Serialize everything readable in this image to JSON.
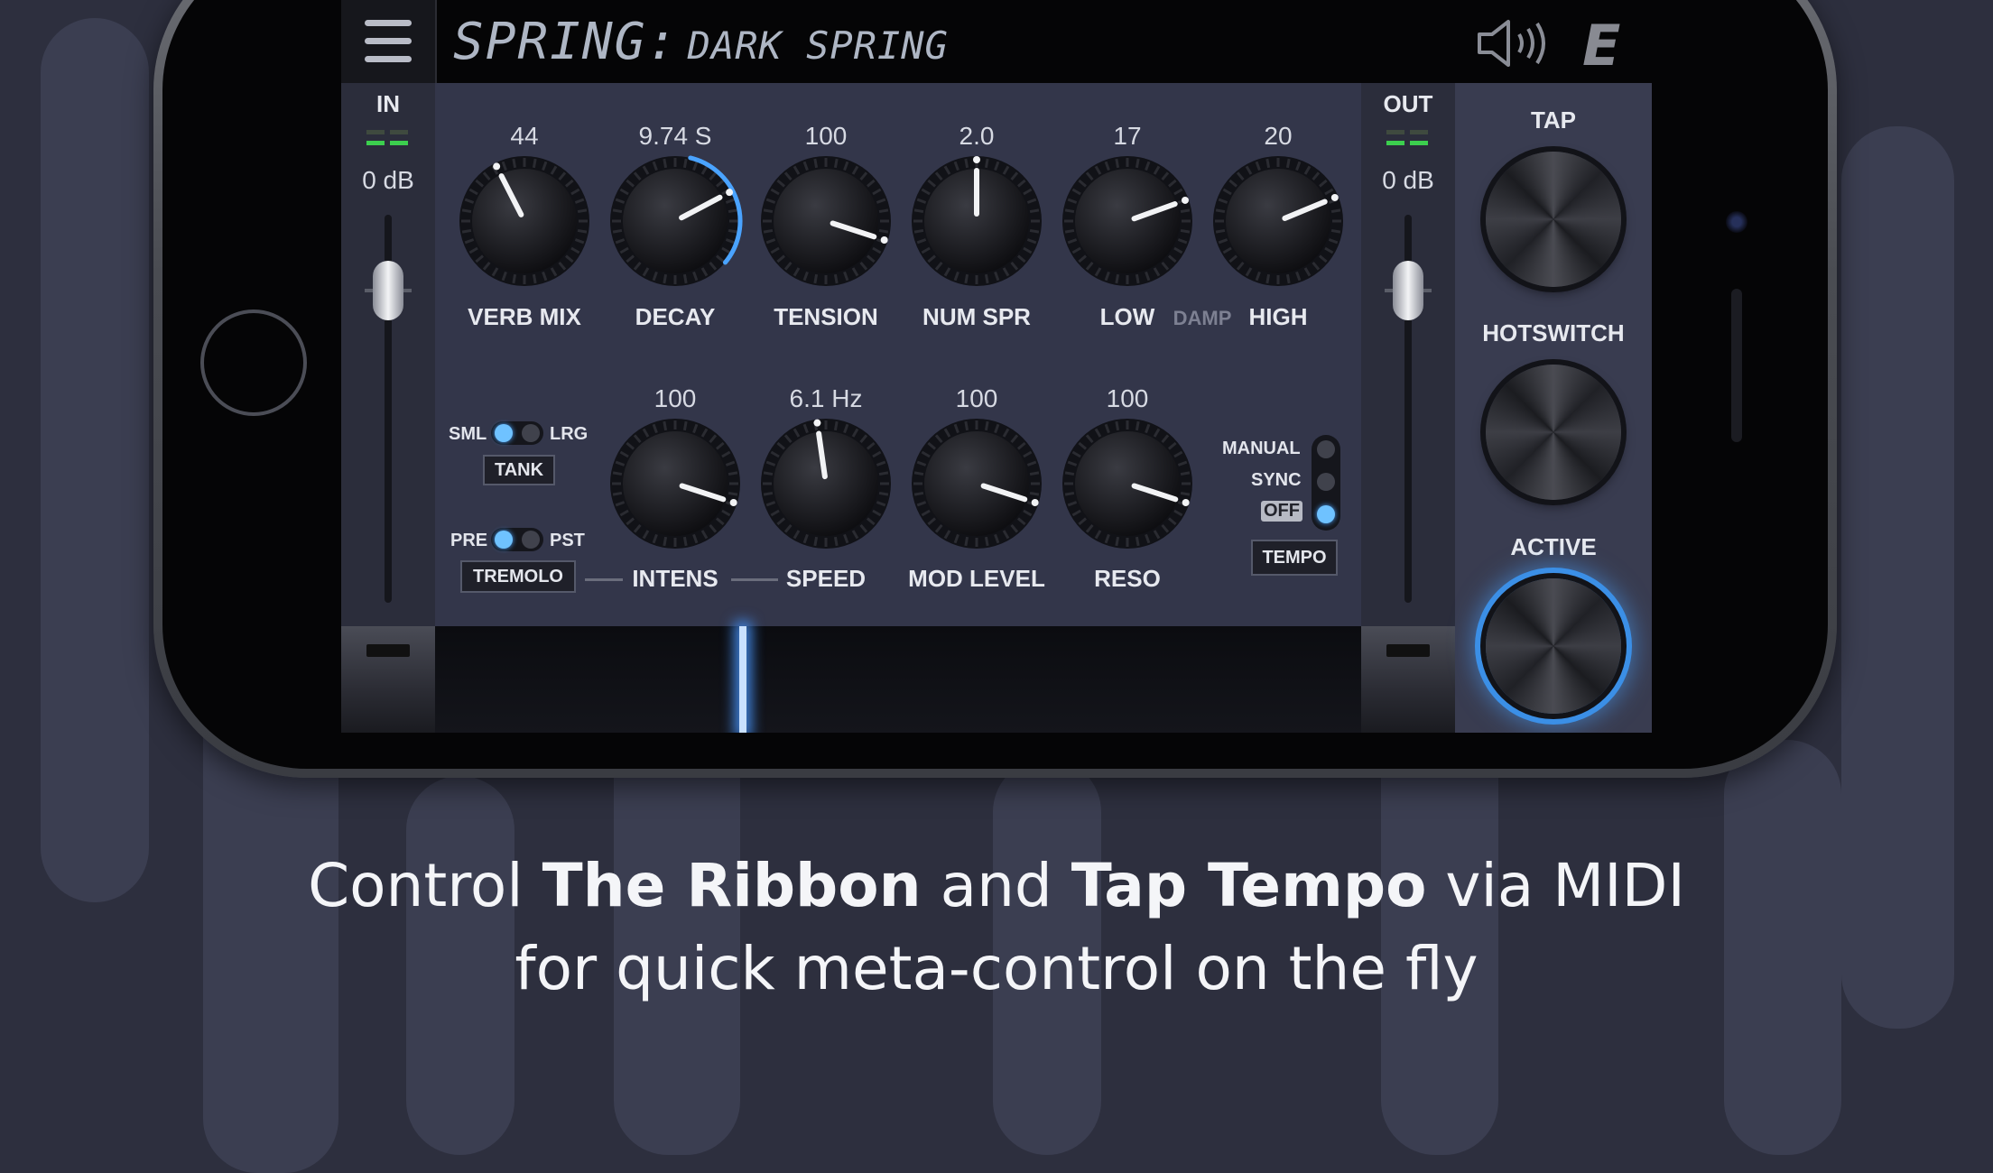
{
  "header": {
    "preset_category": "SPRING:",
    "preset_name": "DARK SPRING"
  },
  "input": {
    "label": "IN",
    "level": "0 dB"
  },
  "output": {
    "label": "OUT",
    "level": "0 dB"
  },
  "knobs_top": [
    {
      "id": "verb-mix",
      "label": "VERB MIX",
      "value": "44"
    },
    {
      "id": "decay",
      "label": "DECAY",
      "value": "9.74 S"
    },
    {
      "id": "tension",
      "label": "TENSION",
      "value": "100"
    },
    {
      "id": "num-spr",
      "label": "NUM SPR",
      "value": "2.0"
    },
    {
      "id": "damp-low",
      "label": "LOW",
      "value": "17"
    },
    {
      "id": "damp-high",
      "label": "HIGH",
      "value": "20"
    }
  ],
  "damp_label": "DAMP",
  "knobs_bottom": [
    {
      "id": "intens",
      "label": "INTENS",
      "value": "100"
    },
    {
      "id": "speed",
      "label": "SPEED",
      "value": "6.1 Hz"
    },
    {
      "id": "mod-level",
      "label": "MOD LEVEL",
      "value": "100"
    },
    {
      "id": "reso",
      "label": "RESO",
      "value": "100"
    }
  ],
  "tank": {
    "left": "SML",
    "right": "LRG",
    "button": "TANK"
  },
  "tremolo": {
    "left": "PRE",
    "right": "PST",
    "button": "TREMOLO"
  },
  "tempo": {
    "manual": "MANUAL",
    "sync": "SYNC",
    "off": "OFF",
    "button": "TEMPO"
  },
  "footswitches": {
    "tap": "TAP",
    "hotswitch": "HOTSWITCH",
    "active": "ACTIVE"
  },
  "caption": {
    "l1a": "Control ",
    "l1b": "The Ribbon",
    "l1c": " and ",
    "l1d": "Tap Tempo",
    "l1e": " via MIDI",
    "l2": "for quick meta-control on the fly"
  },
  "colors": {
    "accent": "#4aa3ff",
    "meter_green": "#3ccf4e",
    "background": "#2d2f3e"
  }
}
